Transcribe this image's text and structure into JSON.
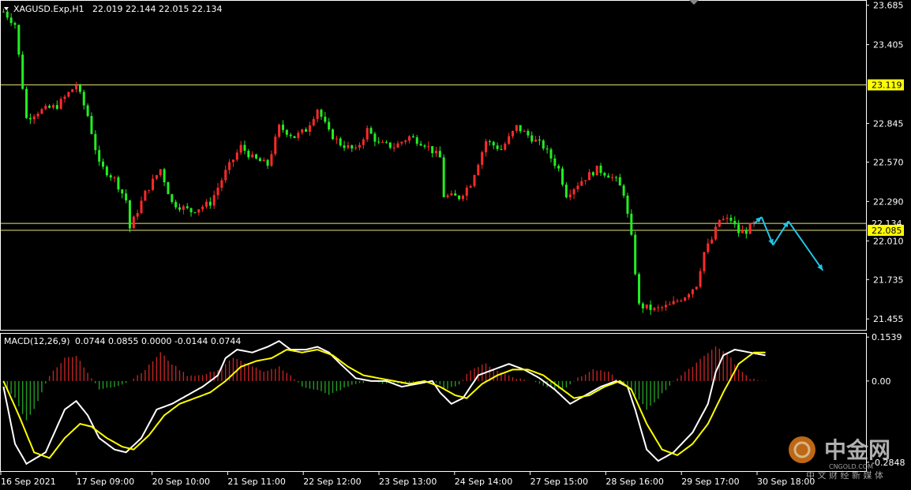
{
  "header": {
    "symbol": "XAGUSD.Exp,H1",
    "ohlc": "22.019 22.144 22.015 22.134"
  },
  "colors": {
    "background": "#000000",
    "bull": "#ff2a2a",
    "bear": "#22ee22",
    "hline": "#ffff80",
    "white_line": "#ffffff",
    "signal_line": "#ffff00",
    "arrow": "#22c6e6"
  },
  "chart_data": [
    {
      "type": "candlestick",
      "name": "XAGUSD.Exp,H1",
      "ylim": [
        21.4,
        23.7
      ],
      "yticks": [
        "23.685",
        "23.405",
        "22.845",
        "22.570",
        "22.290",
        "22.010",
        "21.735",
        "21.455"
      ],
      "price_labels": [
        {
          "value": 23.119,
          "text": "23.119",
          "highlight": true
        },
        {
          "value": 22.134,
          "text": "22.134",
          "highlight": false
        },
        {
          "value": 22.085,
          "text": "22.085",
          "highlight": true
        }
      ],
      "horizontal_lines": [
        23.119,
        22.134,
        22.085
      ],
      "x_labels": [
        "16 Sep 2021",
        "17 Sep 09:00",
        "20 Sep 10:00",
        "21 Sep 11:00",
        "22 Sep 12:00",
        "23 Sep 13:00",
        "24 Sep 14:00",
        "27 Sep 15:00",
        "28 Sep 16:00",
        "29 Sep 17:00",
        "30 Sep 18:00"
      ],
      "close_path": [
        [
          0,
          23.64
        ],
        [
          3,
          23.55
        ],
        [
          6,
          22.88
        ],
        [
          9,
          22.93
        ],
        [
          14,
          22.97
        ],
        [
          19,
          23.12
        ],
        [
          22,
          22.9
        ],
        [
          25,
          22.55
        ],
        [
          29,
          22.45
        ],
        [
          32,
          22.3
        ],
        [
          33,
          22.1
        ],
        [
          37,
          22.35
        ],
        [
          41,
          22.52
        ],
        [
          44,
          22.28
        ],
        [
          49,
          22.22
        ],
        [
          54,
          22.28
        ],
        [
          58,
          22.5
        ],
        [
          62,
          22.68
        ],
        [
          65,
          22.6
        ],
        [
          69,
          22.55
        ],
        [
          72,
          22.82
        ],
        [
          76,
          22.75
        ],
        [
          79,
          22.8
        ],
        [
          82,
          22.95
        ],
        [
          85,
          22.78
        ],
        [
          88,
          22.7
        ],
        [
          92,
          22.65
        ],
        [
          95,
          22.8
        ],
        [
          98,
          22.7
        ],
        [
          102,
          22.68
        ],
        [
          106,
          22.75
        ],
        [
          110,
          22.7
        ],
        [
          114,
          22.6
        ],
        [
          115,
          22.33
        ],
        [
          119,
          22.32
        ],
        [
          122,
          22.42
        ],
        [
          126,
          22.72
        ],
        [
          130,
          22.66
        ],
        [
          134,
          22.82
        ],
        [
          138,
          22.74
        ],
        [
          141,
          22.68
        ],
        [
          145,
          22.52
        ],
        [
          147,
          22.34
        ],
        [
          151,
          22.44
        ],
        [
          155,
          22.52
        ],
        [
          158,
          22.48
        ],
        [
          160,
          22.44
        ],
        [
          162,
          22.35
        ],
        [
          164,
          22.03
        ],
        [
          166,
          21.55
        ],
        [
          170,
          21.52
        ],
        [
          174,
          21.55
        ],
        [
          178,
          21.62
        ],
        [
          181,
          21.7
        ],
        [
          183,
          21.93
        ],
        [
          185,
          22.02
        ],
        [
          187,
          22.16
        ],
        [
          190,
          22.16
        ],
        [
          192,
          22.07
        ],
        [
          194,
          22.08
        ],
        [
          196,
          22.13
        ]
      ],
      "projection_path": [
        [
          196,
          22.13
        ],
        [
          198,
          22.18
        ],
        [
          201,
          21.98
        ],
        [
          205,
          22.15
        ],
        [
          214,
          21.8
        ]
      ]
    },
    {
      "type": "line",
      "name": "MACD(12,26,9)",
      "values_text": "0.0744 0.0855 0.0000 -0.0144 0.0744",
      "ylim": [
        -0.31,
        0.16
      ],
      "yticks": [
        "0.1539",
        "0.00",
        "-0.2848"
      ],
      "series": [
        {
          "id": "white",
          "values": [
            [
              0,
              -0.02
            ],
            [
              3,
              -0.22
            ],
            [
              6,
              -0.29
            ],
            [
              11,
              -0.25
            ],
            [
              16,
              -0.1
            ],
            [
              19,
              -0.07
            ],
            [
              22,
              -0.12
            ],
            [
              25,
              -0.2
            ],
            [
              29,
              -0.24
            ],
            [
              32,
              -0.25
            ],
            [
              36,
              -0.2
            ],
            [
              40,
              -0.1
            ],
            [
              44,
              -0.08
            ],
            [
              48,
              -0.05
            ],
            [
              52,
              -0.02
            ],
            [
              56,
              0.02
            ],
            [
              58,
              0.08
            ],
            [
              61,
              0.11
            ],
            [
              65,
              0.1
            ],
            [
              69,
              0.12
            ],
            [
              72,
              0.14
            ],
            [
              75,
              0.11
            ],
            [
              79,
              0.11
            ],
            [
              82,
              0.12
            ],
            [
              85,
              0.1
            ],
            [
              88,
              0.06
            ],
            [
              92,
              0.01
            ],
            [
              96,
              0.0
            ],
            [
              100,
              0.0
            ],
            [
              104,
              -0.02
            ],
            [
              108,
              -0.01
            ],
            [
              112,
              0.0
            ],
            [
              114,
              -0.04
            ],
            [
              117,
              -0.08
            ],
            [
              120,
              -0.06
            ],
            [
              124,
              0.02
            ],
            [
              128,
              0.04
            ],
            [
              132,
              0.06
            ],
            [
              136,
              0.04
            ],
            [
              140,
              0.01
            ],
            [
              144,
              -0.03
            ],
            [
              148,
              -0.08
            ],
            [
              152,
              -0.05
            ],
            [
              156,
              -0.02
            ],
            [
              160,
              0.0
            ],
            [
              163,
              -0.02
            ],
            [
              165,
              -0.1
            ],
            [
              168,
              -0.24
            ],
            [
              171,
              -0.28
            ],
            [
              175,
              -0.25
            ],
            [
              180,
              -0.18
            ],
            [
              184,
              -0.08
            ],
            [
              186,
              0.03
            ],
            [
              188,
              0.09
            ],
            [
              191,
              0.11
            ],
            [
              195,
              0.1
            ],
            [
              199,
              0.09
            ]
          ]
        },
        {
          "id": "yellow",
          "values": [
            [
              0,
              0.0
            ],
            [
              4,
              -0.12
            ],
            [
              8,
              -0.25
            ],
            [
              12,
              -0.27
            ],
            [
              16,
              -0.2
            ],
            [
              20,
              -0.15
            ],
            [
              23,
              -0.16
            ],
            [
              27,
              -0.2
            ],
            [
              31,
              -0.23
            ],
            [
              34,
              -0.24
            ],
            [
              38,
              -0.19
            ],
            [
              42,
              -0.12
            ],
            [
              46,
              -0.08
            ],
            [
              50,
              -0.06
            ],
            [
              54,
              -0.04
            ],
            [
              58,
              0.0
            ],
            [
              62,
              0.05
            ],
            [
              66,
              0.07
            ],
            [
              70,
              0.08
            ],
            [
              74,
              0.11
            ],
            [
              78,
              0.1
            ],
            [
              82,
              0.11
            ],
            [
              86,
              0.09
            ],
            [
              90,
              0.05
            ],
            [
              94,
              0.02
            ],
            [
              98,
              0.01
            ],
            [
              102,
              0.0
            ],
            [
              106,
              -0.01
            ],
            [
              110,
              0.0
            ],
            [
              114,
              -0.02
            ],
            [
              118,
              -0.05
            ],
            [
              121,
              -0.06
            ],
            [
              125,
              -0.01
            ],
            [
              129,
              0.02
            ],
            [
              133,
              0.04
            ],
            [
              137,
              0.04
            ],
            [
              141,
              0.02
            ],
            [
              145,
              -0.02
            ],
            [
              149,
              -0.06
            ],
            [
              153,
              -0.05
            ],
            [
              157,
              -0.02
            ],
            [
              161,
              0.0
            ],
            [
              164,
              -0.03
            ],
            [
              168,
              -0.15
            ],
            [
              172,
              -0.24
            ],
            [
              176,
              -0.26
            ],
            [
              180,
              -0.22
            ],
            [
              184,
              -0.15
            ],
            [
              188,
              -0.04
            ],
            [
              192,
              0.06
            ],
            [
              196,
              0.1
            ],
            [
              199,
              0.1
            ]
          ]
        }
      ],
      "histogram_path": [
        [
          0,
          -0.01
        ],
        [
          3,
          -0.06
        ],
        [
          6,
          -0.14
        ],
        [
          8,
          -0.1
        ],
        [
          12,
          0.02
        ],
        [
          16,
          0.08
        ],
        [
          19,
          0.09
        ],
        [
          22,
          0.03
        ],
        [
          25,
          -0.03
        ],
        [
          29,
          -0.02
        ],
        [
          33,
          0.0
        ],
        [
          37,
          0.04
        ],
        [
          41,
          0.1
        ],
        [
          44,
          0.06
        ],
        [
          48,
          0.02
        ],
        [
          52,
          0.02
        ],
        [
          56,
          0.04
        ],
        [
          60,
          0.08
        ],
        [
          64,
          0.06
        ],
        [
          68,
          0.03
        ],
        [
          72,
          0.05
        ],
        [
          75,
          0.02
        ],
        [
          78,
          -0.02
        ],
        [
          82,
          -0.03
        ],
        [
          85,
          -0.05
        ],
        [
          88,
          -0.03
        ],
        [
          92,
          -0.01
        ],
        [
          96,
          0.0
        ],
        [
          100,
          -0.01
        ],
        [
          104,
          -0.01
        ],
        [
          108,
          0.0
        ],
        [
          112,
          0.0
        ],
        [
          116,
          -0.03
        ],
        [
          119,
          -0.01
        ],
        [
          122,
          0.04
        ],
        [
          126,
          0.06
        ],
        [
          130,
          0.03
        ],
        [
          134,
          0.01
        ],
        [
          138,
          0.0
        ],
        [
          142,
          -0.02
        ],
        [
          146,
          -0.03
        ],
        [
          150,
          0.01
        ],
        [
          154,
          0.04
        ],
        [
          158,
          0.03
        ],
        [
          162,
          -0.01
        ],
        [
          165,
          -0.05
        ],
        [
          168,
          -0.1
        ],
        [
          171,
          -0.06
        ],
        [
          175,
          0.0
        ],
        [
          179,
          0.04
        ],
        [
          183,
          0.09
        ],
        [
          186,
          0.12
        ],
        [
          189,
          0.1
        ],
        [
          192,
          0.04
        ],
        [
          195,
          0.01
        ],
        [
          199,
          0.0
        ]
      ]
    }
  ],
  "watermark": {
    "brand": "中金网",
    "site": "CNGOLD.COM",
    "tagline": "中 文 财 经 新 媒 体"
  }
}
